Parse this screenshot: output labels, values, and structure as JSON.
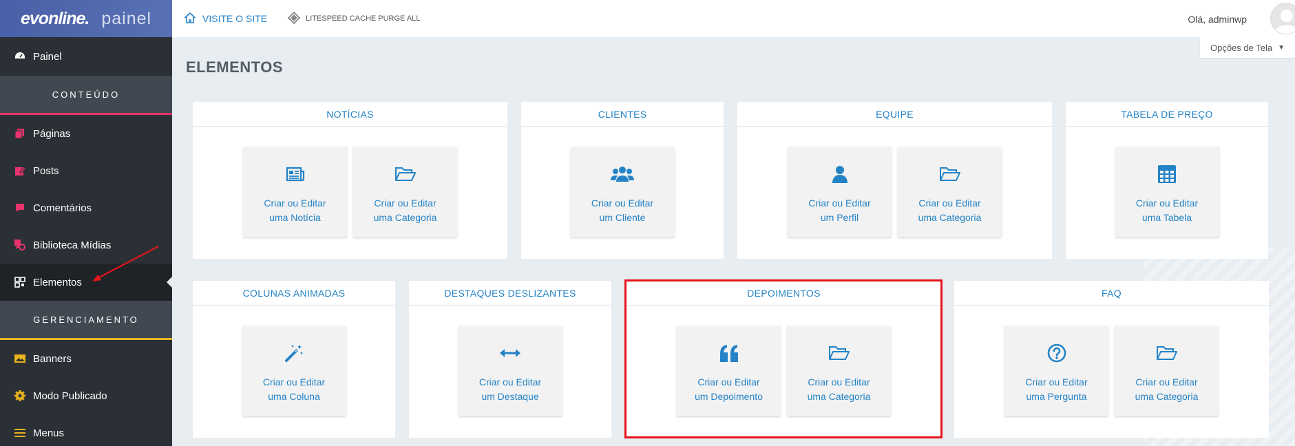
{
  "sidebar": {
    "logo_brand": "evonline.",
    "logo_panel": "painel",
    "painel": "Painel",
    "section_content": "CONTEÚDO",
    "items_content": [
      "Páginas",
      "Posts",
      "Comentários",
      "Biblioteca Mídias",
      "Elementos"
    ],
    "section_manage": "GERENCIAMENTO",
    "items_manage": [
      "Banners",
      "Modo Publicado",
      "Menus"
    ]
  },
  "topbar": {
    "visit_site": "VISITE O SITE",
    "litespeed": "LITESPEED CACHE PURGE ALL",
    "greeting": "Olá, adminwp",
    "screen_options": "Opções de Tela",
    "screen_options_arrow": "▼"
  },
  "page": {
    "title": "ELEMENTOS"
  },
  "cards": {
    "noticias": {
      "title": "NOTÍCIAS",
      "tiles": [
        [
          "Criar ou Editar",
          "uma Notícia"
        ],
        [
          "Criar ou Editar",
          "uma Categoria"
        ]
      ]
    },
    "clientes": {
      "title": "CLIENTES",
      "tiles": [
        [
          "Criar ou Editar",
          "um Cliente"
        ]
      ]
    },
    "equipe": {
      "title": "EQUIPE",
      "tiles": [
        [
          "Criar ou Editar",
          "um Perfil"
        ],
        [
          "Criar ou Editar",
          "uma Categoria"
        ]
      ]
    },
    "tabela": {
      "title": "TABELA DE PREÇO",
      "tiles": [
        [
          "Criar ou Editar",
          "uma Tabela"
        ]
      ]
    },
    "colunas": {
      "title": "COLUNAS ANIMADAS",
      "tiles": [
        [
          "Criar ou Editar",
          "uma Coluna"
        ]
      ]
    },
    "destaques": {
      "title": "DESTAQUES DESLIZANTES",
      "tiles": [
        [
          "Criar ou Editar",
          "um Destaque"
        ]
      ]
    },
    "depoimentos": {
      "title": "DEPOIMENTOS",
      "tiles": [
        [
          "Criar ou Editar",
          "um Depoimento"
        ],
        [
          "Criar ou Editar",
          "uma Categoria"
        ]
      ]
    },
    "faq": {
      "title": "FAQ",
      "tiles": [
        [
          "Criar ou Editar",
          "uma Pergunta"
        ],
        [
          "Criar ou Editar",
          "uma Categoria"
        ]
      ]
    }
  },
  "colors": {
    "accent": "#2383c6",
    "sidebar": "#2b3036",
    "highlight": "#e4141b",
    "pink": "#e8336d",
    "yellow": "#e9b31c"
  }
}
